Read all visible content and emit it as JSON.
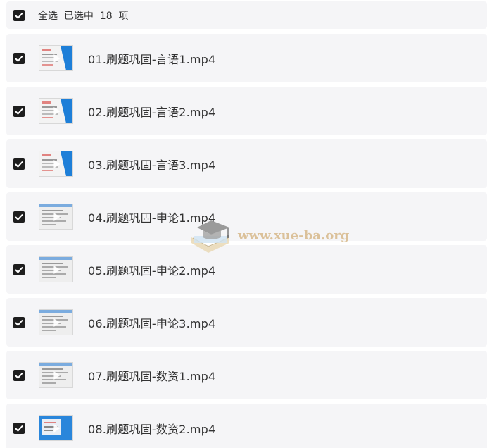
{
  "select_all": {
    "checked": true,
    "label": "全选  已选中  18  项"
  },
  "files": [
    {
      "name": "01.刷题巩固-言语1.mp4",
      "checked": true,
      "thumb_style": "blue"
    },
    {
      "name": "02.刷题巩固-言语2.mp4",
      "checked": true,
      "thumb_style": "blue"
    },
    {
      "name": "03.刷题巩固-言语3.mp4",
      "checked": true,
      "thumb_style": "blue"
    },
    {
      "name": "04.刷题巩固-申论1.mp4",
      "checked": true,
      "thumb_style": "grey"
    },
    {
      "name": "05.刷题巩固-申论2.mp4",
      "checked": true,
      "thumb_style": "grey"
    },
    {
      "name": "06.刷题巩固-申论3.mp4",
      "checked": true,
      "thumb_style": "grey"
    },
    {
      "name": "07.刷题巩固-数资1.mp4",
      "checked": true,
      "thumb_style": "grey"
    },
    {
      "name": "08.刷题巩固-数资2.mp4",
      "checked": true,
      "thumb_style": "blue-full"
    }
  ],
  "watermark": {
    "text": "www.xue-ba.org"
  },
  "colors": {
    "row_background": "#f5f5f7",
    "checkbox": "#1e1e1e",
    "text": "#333333",
    "watermark": "#d7b98a",
    "thumb_accent": "#1e7fd8"
  }
}
